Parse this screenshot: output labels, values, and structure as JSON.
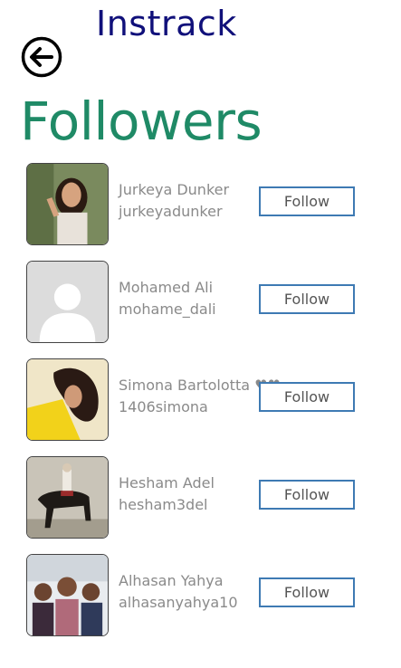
{
  "app": {
    "title": "Instrack"
  },
  "header": {
    "back_icon": "back-arrow-icon",
    "page_title": "Followers"
  },
  "followers": [
    {
      "name": "Jurkeya Dunker",
      "username": "jurkeyadunker",
      "action": "Follow"
    },
    {
      "name": "Mohamed Ali",
      "username": "mohame_dali",
      "action": "Follow"
    },
    {
      "name": "Simona Bartolotta ♥♥",
      "username": "1406simona",
      "action": "Follow"
    },
    {
      "name": "Hesham Adel",
      "username": "hesham3del",
      "action": "Follow"
    },
    {
      "name": "Alhasan Yahya",
      "username": "alhasanyahya10",
      "action": "Follow"
    }
  ],
  "colors": {
    "title": "#10107a",
    "heading": "#1f8a66",
    "button_border": "#3e7ab3",
    "text_muted": "#8a8a8a"
  }
}
